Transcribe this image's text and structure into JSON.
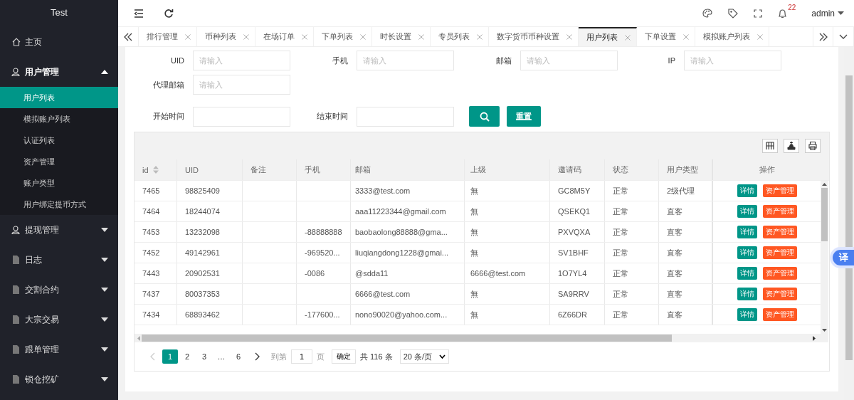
{
  "sidebar": {
    "logo": "Test",
    "items": [
      {
        "label": "主页",
        "kind": "home"
      },
      {
        "label": "用户管理",
        "kind": "user",
        "expanded": true,
        "children": [
          {
            "label": "用户列表",
            "selected": true
          },
          {
            "label": "模拟账户列表",
            "selected": false
          },
          {
            "label": "认证列表",
            "selected": false
          },
          {
            "label": "资产管理",
            "selected": false
          },
          {
            "label": "账户类型",
            "selected": false
          },
          {
            "label": "用户绑定提币方式",
            "selected": false
          }
        ]
      },
      {
        "label": "提现管理",
        "kind": "user",
        "expanded": false
      },
      {
        "label": "日志",
        "kind": "doc",
        "expanded": false
      },
      {
        "label": "交割合约",
        "kind": "doc",
        "expanded": false
      },
      {
        "label": "大宗交易",
        "kind": "doc",
        "expanded": false
      },
      {
        "label": "跟单管理",
        "kind": "doc",
        "expanded": false
      },
      {
        "label": "锁仓挖矿",
        "kind": "doc",
        "expanded": false
      }
    ]
  },
  "header": {
    "notification_count": "22",
    "user": "admin"
  },
  "tabs": [
    {
      "label": "排行管理",
      "selected": false
    },
    {
      "label": "币种列表",
      "selected": false
    },
    {
      "label": "在场订单",
      "selected": false
    },
    {
      "label": "下单列表",
      "selected": false
    },
    {
      "label": "时长设置",
      "selected": false
    },
    {
      "label": "专员列表",
      "selected": false
    },
    {
      "label": "数字货币币种设置",
      "selected": false
    },
    {
      "label": "用户列表",
      "selected": true
    },
    {
      "label": "下单设置",
      "selected": false
    },
    {
      "label": "模拟账户列表",
      "selected": false
    }
  ],
  "filters": [
    {
      "label": "UID",
      "placeholder": "请输入"
    },
    {
      "label": "手机",
      "placeholder": "请输入"
    },
    {
      "label": "邮箱",
      "placeholder": "请输入"
    },
    {
      "label": "IP",
      "placeholder": "请输入"
    },
    {
      "label": "代理邮箱",
      "placeholder": "请输入"
    },
    {
      "label": "开始时间"
    },
    {
      "label": "结束时间"
    }
  ],
  "reset_button": "重置",
  "table": {
    "columns": [
      "id",
      "UID",
      "备注",
      "手机",
      "邮箱",
      "上级",
      "邀请码",
      "状态",
      "用户类型",
      "操作"
    ],
    "rows": [
      {
        "cells": [
          "7465",
          "98825409",
          "",
          "",
          "3333@test.com",
          "無",
          "GC8M5Y",
          "正常",
          "2级代理"
        ],
        "actions": [
          "详情",
          "资产管理"
        ]
      },
      {
        "cells": [
          "7464",
          "18244074",
          "",
          "",
          "aaa11223344@gmail.com",
          "無",
          "QSEKQ1",
          "正常",
          "直客"
        ],
        "actions": [
          "详情",
          "资产管理"
        ]
      },
      {
        "cells": [
          "7453",
          "13232098",
          "",
          "-88888888",
          "baobaolong88888@gma...",
          "無",
          "PXVQXA",
          "正常",
          "直客"
        ],
        "actions": [
          "详情",
          "资产管理"
        ]
      },
      {
        "cells": [
          "7452",
          "49142961",
          "",
          "-969520...",
          "liuqiangdong1228@gmai...",
          "無",
          "SV1BHF",
          "正常",
          "直客"
        ],
        "actions": [
          "详情",
          "资产管理"
        ]
      },
      {
        "cells": [
          "7443",
          "20902531",
          "",
          "-0086",
          "@sdda11",
          "6666@test.com",
          "1O7YL4",
          "正常",
          "直客"
        ],
        "actions": [
          "详情",
          "资产管理"
        ]
      },
      {
        "cells": [
          "7437",
          "80037353",
          "",
          "",
          "6666@test.com",
          "無",
          "SA9RRV",
          "正常",
          "直客"
        ],
        "actions": [
          "详情",
          "资产管理"
        ]
      },
      {
        "cells": [
          "7434",
          "68893462",
          "",
          "-177600...",
          "nono90020@yahoo.com...",
          "無",
          "6Z66DR",
          "正常",
          "直客"
        ],
        "actions": [
          "详情",
          "资产管理"
        ]
      }
    ]
  },
  "pagination": {
    "pages": [
      {
        "label": "1",
        "selected": true
      },
      {
        "label": "2",
        "selected": false
      },
      {
        "label": "3",
        "selected": false
      },
      {
        "label": "…",
        "selected": false
      },
      {
        "label": "6",
        "selected": false
      }
    ],
    "goto_label": "到第",
    "goto_value": "1",
    "page_unit": "页",
    "confirm": "确定",
    "total": "共 116 条",
    "page_size": "20 条/页"
  },
  "translate_badge": "译"
}
